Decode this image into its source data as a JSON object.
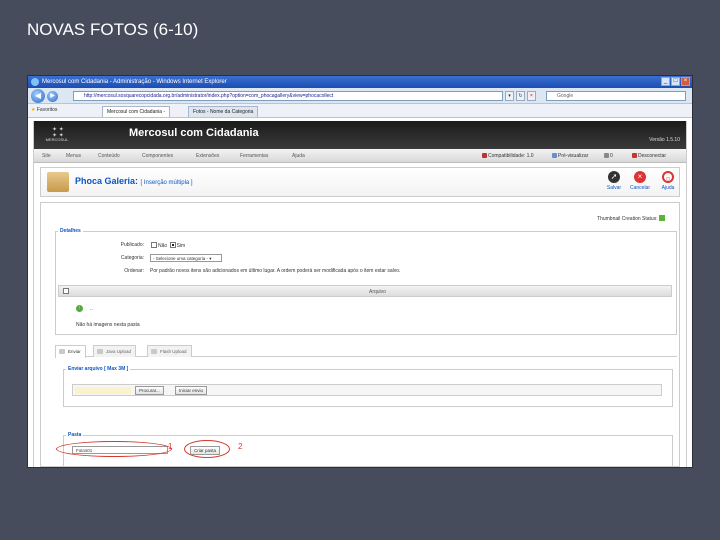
{
  "slide": {
    "title": "NOVAS FOTOS (6-10)"
  },
  "browser": {
    "window_title": "Mercosul com Cidadania - Administração - Windows Internet Explorer",
    "url": "http://mercosul.sosquarecopcidada.org.br/administrator/index.php?option=com_phocagallery&view=phocacollect",
    "search_placeholder": "Google",
    "favorites_label": "Favoritos",
    "tabs": [
      {
        "label": "Mercosul com Cidadania -"
      },
      {
        "label": "Fotos - Nome da Categoria"
      }
    ]
  },
  "joomla": {
    "site_name": "Mercosul com Cidadania",
    "logo_text": "MERCOSUL",
    "version": "Versão 1.5.10",
    "menu": [
      "Site",
      "Menus",
      "Conteúdo",
      "Componentes",
      "Extensões",
      "Ferramentas",
      "Ajuda"
    ],
    "status": {
      "compat": "Compatibilidade: 1.0",
      "preview": "Pré-visualizar",
      "messages": "0",
      "logout": "Desconectar"
    },
    "colors": {
      "link": "#0b55c4",
      "header": "#1b1b1b"
    }
  },
  "component": {
    "title": "Phoca Galeria:",
    "subtitle": "[ Inserção múltipla ]",
    "toolbar": {
      "save": "Salvar",
      "cancel": "Cancelar",
      "help": "Ajuda"
    },
    "thumb_status": "Thumbnail Creation Status:",
    "details": {
      "legend": "Detalhes",
      "published_label": "Publicado:",
      "published_no": "Não",
      "published_yes": "Sim",
      "category_label": "Categoria:",
      "category_value": "- Selecione uma categoria -",
      "order_label": "Ordenar:",
      "order_text": "Por padrão novos itens são adicionados em último lugar. A ordem poderá ser modificada após o item estar salvo.",
      "column_file": "Arquivo",
      "up_dots": "..",
      "no_images": "Não há imagens nesta pasta"
    },
    "upload_tabs": [
      "Enviar",
      "Java Upload",
      "Flash Upload"
    ],
    "send": {
      "legend": "Enviar arquivo [ Max 3M ]",
      "browse": "Procurar...",
      "start": "Iniciar envio"
    },
    "folder": {
      "legend": "Pasta",
      "value": "Fotos01",
      "create": "Criar pasta"
    }
  },
  "annotations": {
    "mark1": "1",
    "mark2": "2"
  }
}
